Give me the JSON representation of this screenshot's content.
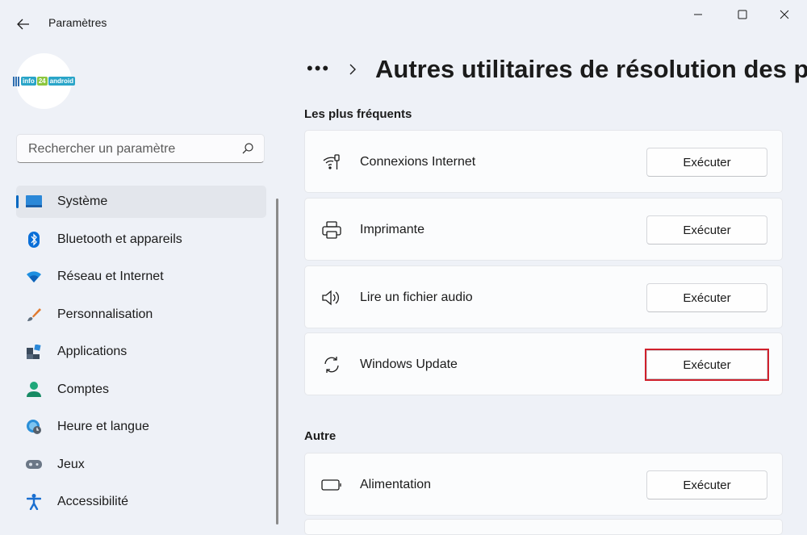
{
  "window": {
    "title": "Paramètres",
    "controls": [
      "minimize-icon",
      "maximize-icon",
      "close-icon"
    ]
  },
  "profile": {
    "logo_text_1": "info",
    "logo_text_2": "24",
    "logo_text_3": "android"
  },
  "search": {
    "placeholder": "Rechercher un paramètre"
  },
  "nav": {
    "items": [
      {
        "label": "Système",
        "icon": "system-icon",
        "selected": true
      },
      {
        "label": "Bluetooth et appareils",
        "icon": "bluetooth-icon"
      },
      {
        "label": "Réseau et Internet",
        "icon": "wifi-icon"
      },
      {
        "label": "Personnalisation",
        "icon": "brush-icon"
      },
      {
        "label": "Applications",
        "icon": "apps-icon"
      },
      {
        "label": "Comptes",
        "icon": "account-icon"
      },
      {
        "label": "Heure et langue",
        "icon": "globe-clock-icon"
      },
      {
        "label": "Jeux",
        "icon": "gamepad-icon"
      },
      {
        "label": "Accessibilité",
        "icon": "accessibility-icon"
      }
    ]
  },
  "header": {
    "breadcrumb_more": "•••",
    "title": "Autres utilitaires de résolution des pr"
  },
  "sections": {
    "frequent": {
      "title": "Les plus fréquents",
      "items": [
        {
          "label": "Connexions Internet",
          "icon": "network-icon",
          "button": "Exécuter"
        },
        {
          "label": "Imprimante",
          "icon": "printer-icon",
          "button": "Exécuter"
        },
        {
          "label": "Lire un fichier audio",
          "icon": "speaker-icon",
          "button": "Exécuter"
        },
        {
          "label": "Windows Update",
          "icon": "sync-icon",
          "button": "Exécuter",
          "highlighted": true
        }
      ]
    },
    "other": {
      "title": "Autre",
      "items": [
        {
          "label": "Alimentation",
          "icon": "battery-icon",
          "button": "Exécuter"
        }
      ]
    }
  },
  "colors": {
    "accent": "#0067c0",
    "highlight_border": "#d0202c",
    "background": "#eef1f7"
  }
}
